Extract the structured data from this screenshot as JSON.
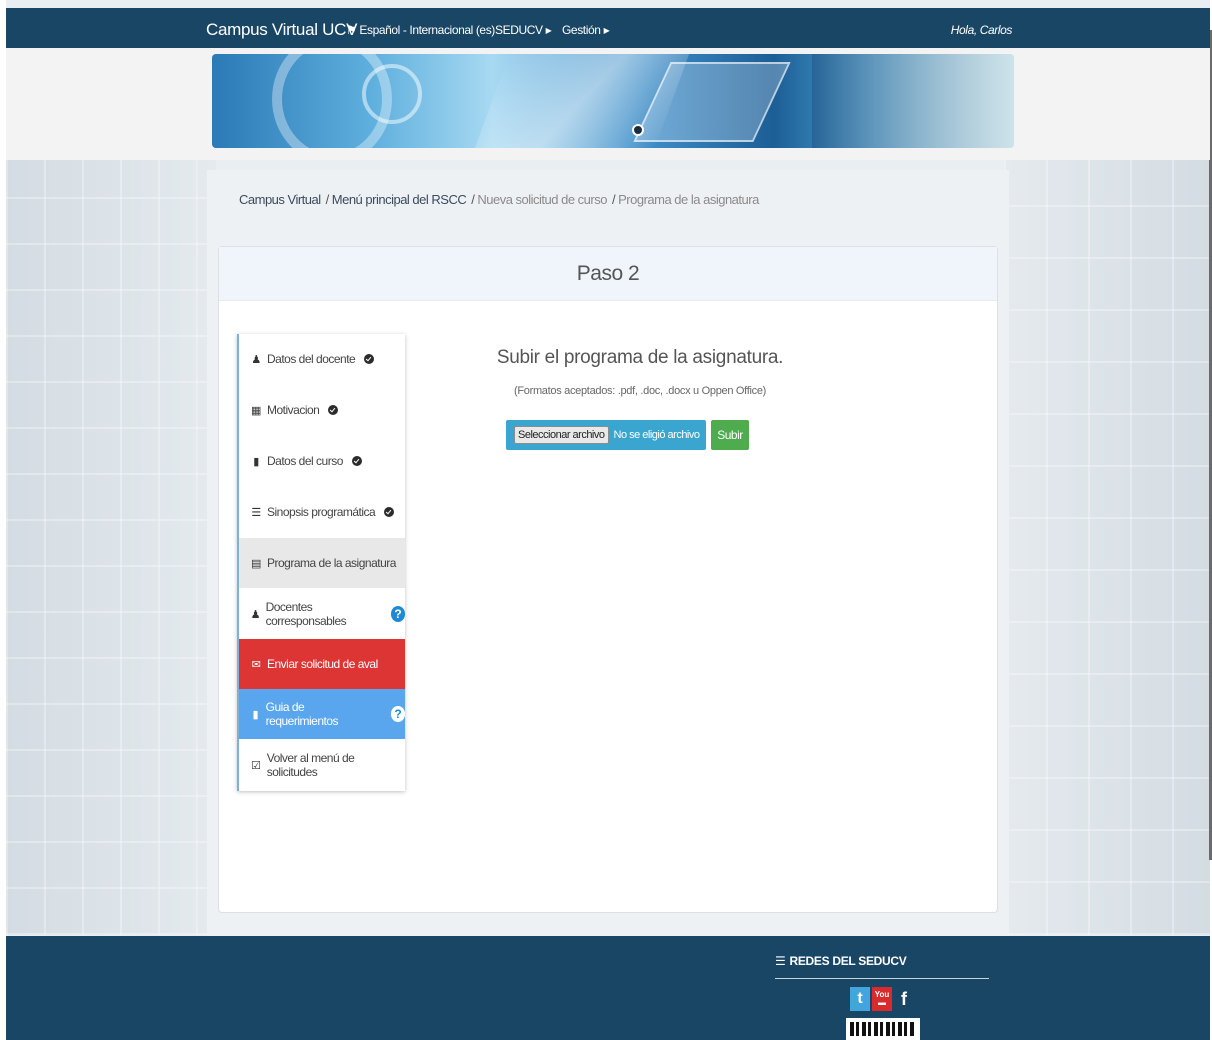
{
  "navbar": {
    "brand": "Campus Virtual UCV",
    "language": "Español - Internacional (es)",
    "menu_seducv": "SEDUCV",
    "menu_gestion": "Gestión",
    "greeting": "Hola, Carlos"
  },
  "breadcrumb": {
    "items": [
      {
        "label": "Campus Virtual"
      },
      {
        "label": "Menú principal del RSCC"
      },
      {
        "label": "Nueva solicitud de curso"
      },
      {
        "label": "Programa de la asignatura"
      }
    ]
  },
  "panel": {
    "title": "Paso 2"
  },
  "side_menu": {
    "items": [
      {
        "label": "Datos del docente",
        "icon": "user-icon",
        "status": "check"
      },
      {
        "label": "Motivacion",
        "icon": "list-icon",
        "status": "check"
      },
      {
        "label": "Datos del curso",
        "icon": "book-icon",
        "status": "check"
      },
      {
        "label": "Sinopsis programática",
        "icon": "list-icon",
        "status": "check"
      },
      {
        "label": "Programa de la asignatura",
        "icon": "document-icon",
        "status": "active"
      },
      {
        "label": "Docentes corresponsables",
        "icon": "user-icon",
        "status": "help"
      },
      {
        "label": "Enviar solicitud de aval",
        "icon": "envelope-icon",
        "status": "danger"
      },
      {
        "label": "Guia de requerimientos",
        "icon": "file-icon",
        "status": "help"
      },
      {
        "label": "Volver al menú de solicitudes",
        "icon": "checkbox-icon",
        "status": "none"
      }
    ]
  },
  "upload": {
    "title": "Subir el programa de la asignatura.",
    "note": "(Formatos aceptados: .pdf, .doc, .docx u Oppen Office)",
    "file_button": "Seleccionar archivo",
    "file_status": "No se eligió archivo",
    "submit": "Subir"
  },
  "footer": {
    "heading": "REDES DEL SEDUCV",
    "social": [
      "twitter-icon",
      "youtube-icon",
      "facebook-icon"
    ]
  },
  "colors": {
    "navbar": "#1a4665",
    "danger": "#dd3434",
    "info": "#5aa6ee",
    "success": "#4eab4e",
    "file_input": "#3aa6cf"
  }
}
